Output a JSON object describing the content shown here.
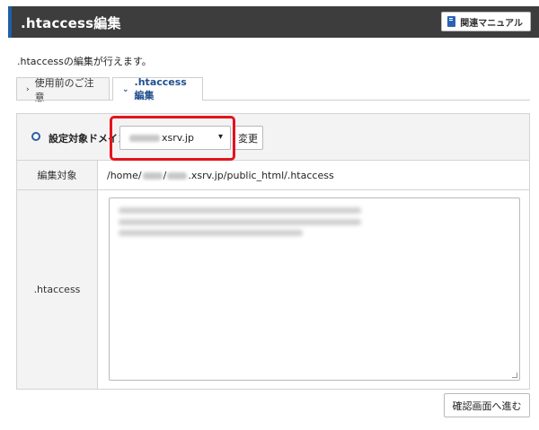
{
  "header": {
    "title": ".htaccess編集",
    "manual_button": "関連マニュアル",
    "accent_color": "#1f5fa8",
    "background_color": "#3d3d3d"
  },
  "description": ".htaccessの編集が行えます。",
  "tabs": [
    {
      "label": "使用前のご注意",
      "active": false
    },
    {
      "label": ".htaccess編集",
      "active": true
    }
  ],
  "form": {
    "domain": {
      "label": "設定対象ドメイン",
      "selected_value": "xsrv.jp",
      "change_button": "変更"
    },
    "target": {
      "label": "編集対象",
      "path_prefix": "/home/",
      "path_mid": "/",
      "path_suffix": ".xsrv.jp/public_html/.htaccess"
    },
    "htaccess": {
      "label": ".htaccess"
    }
  },
  "actions": {
    "confirm_button": "確認画面へ進む"
  },
  "highlight_color": "#e4141c"
}
